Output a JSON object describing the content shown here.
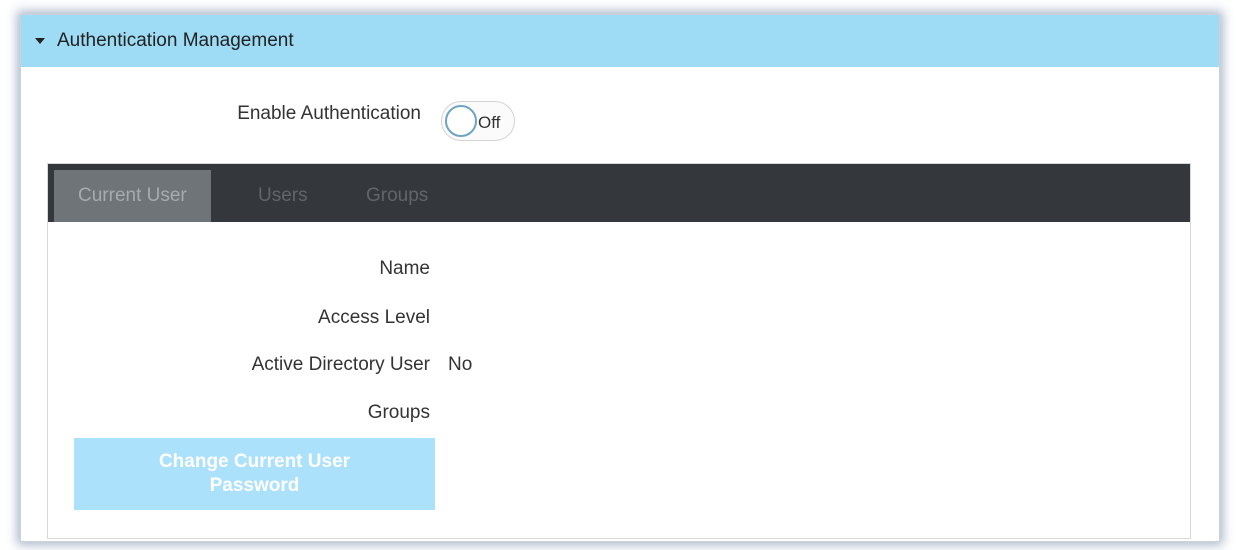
{
  "header": {
    "title": "Authentication Management"
  },
  "auth_toggle": {
    "label": "Enable Authentication",
    "state": "Off"
  },
  "tabs": [
    {
      "label": "Current User",
      "active": true
    },
    {
      "label": "Users",
      "active": false
    },
    {
      "label": "Groups",
      "active": false
    }
  ],
  "current_user": {
    "fields": [
      {
        "label": "Name",
        "value": ""
      },
      {
        "label": "Access Level",
        "value": ""
      },
      {
        "label": "Active Directory User",
        "value": "No"
      },
      {
        "label": "Groups",
        "value": ""
      }
    ],
    "change_password_label": "Change Current User Password"
  },
  "colors": {
    "header_bg": "#9edcf5",
    "tabbar_bg": "#34383c",
    "active_tab_bg": "#6e7478",
    "button_bg": "#ace1fb"
  },
  "icons": {
    "collapse": "caret-down-icon"
  }
}
